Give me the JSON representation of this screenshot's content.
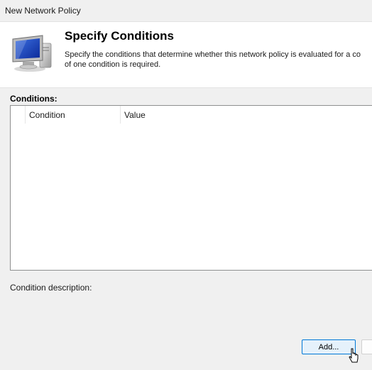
{
  "window": {
    "title": "New Network Policy"
  },
  "header": {
    "icon": "network-computer-icon",
    "title": "Specify Conditions",
    "description": "Specify the conditions that determine whether this network policy is evaluated for a co\nof one condition is required."
  },
  "conditions": {
    "label": "Conditions:",
    "columns": [
      "Condition",
      "Value"
    ],
    "rows": []
  },
  "condition_description": {
    "label": "Condition description:"
  },
  "buttons": {
    "add": "Add..."
  },
  "cursor": "pointer-cursor-icon"
}
